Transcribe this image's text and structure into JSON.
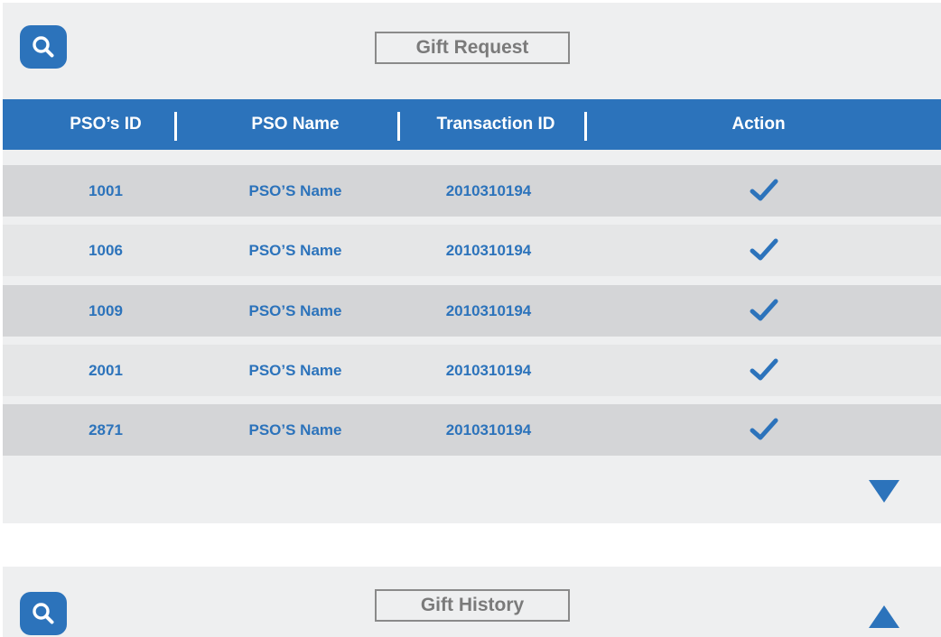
{
  "gift_request": {
    "title": "Gift Request",
    "columns": [
      "PSO’s ID",
      "PSO Name",
      "Transaction ID",
      "Action"
    ],
    "rows": [
      {
        "id": "1001",
        "name": "PSO’S Name",
        "transaction_id": "2010310194",
        "action": "approve"
      },
      {
        "id": "1006",
        "name": "PSO’S Name",
        "transaction_id": "2010310194",
        "action": "approve"
      },
      {
        "id": "1009",
        "name": "PSO’S Name",
        "transaction_id": "2010310194",
        "action": "approve"
      },
      {
        "id": "2001",
        "name": "PSO’S Name",
        "transaction_id": "2010310194",
        "action": "approve"
      },
      {
        "id": "2871",
        "name": "PSO’S Name",
        "transaction_id": "2010310194",
        "action": "approve"
      }
    ],
    "search_icon": "search-icon",
    "expand_icon": "triangle-down-icon"
  },
  "gift_history": {
    "title": "Gift History",
    "search_icon": "search-icon",
    "collapse_icon": "triangle-up-icon"
  },
  "colors": {
    "accent": "#2c73bb",
    "panel_bg": "#eeeff0",
    "row_dark": "#d4d5d7",
    "row_light": "#e5e6e7",
    "title_text": "#7a7a7a"
  }
}
